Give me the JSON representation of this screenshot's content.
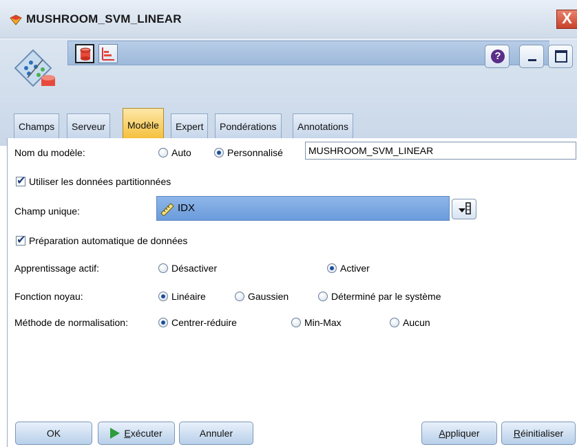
{
  "window": {
    "title": "MUSHROOM_SVM_LINEAR",
    "close_glyph": "X"
  },
  "toolbar": {
    "help_glyph": "?"
  },
  "tabs": [
    {
      "label": "Champs"
    },
    {
      "label": "Serveur"
    },
    {
      "label": "Modèle",
      "active": true
    },
    {
      "label": "Expert"
    },
    {
      "label": "Pondérations"
    },
    {
      "label": "Annotations"
    }
  ],
  "form": {
    "model_name": {
      "label": "Nom du modèle:",
      "options": [
        "Auto",
        "Personnalisé"
      ],
      "selected": "Personnalisé",
      "value": "MUSHROOM_SVM_LINEAR"
    },
    "use_partitioned": {
      "label": "Utiliser les données partitionnées",
      "checked": true
    },
    "unique_field": {
      "label": "Champ unique:",
      "value": "IDX"
    },
    "auto_prep": {
      "label": "Préparation automatique de données",
      "checked": true
    },
    "active_learning": {
      "label": "Apprentissage actif:",
      "options": [
        "Désactiver",
        "Activer"
      ],
      "selected": "Activer"
    },
    "kernel": {
      "label": "Fonction noyau:",
      "options": [
        "Linéaire",
        "Gaussien",
        "Déterminé par le système"
      ],
      "selected": "Linéaire"
    },
    "normalization": {
      "label": "Méthode de normalisation:",
      "options": [
        "Centrer-réduire",
        "Min-Max",
        "Aucun"
      ],
      "selected": "Centrer-réduire"
    }
  },
  "buttons": {
    "ok": "OK",
    "run_u": "E",
    "run_rest": "xécuter",
    "cancel": "Annuler",
    "apply_u": "A",
    "apply_rest": "ppliquer",
    "reset_u": "R",
    "reset_rest": "éinitialiser"
  },
  "colors": {
    "active_tab": "#f5c13e",
    "field_box": "#7aa7e2",
    "run_arrow": "#2e9b3d",
    "close_button": "#c9412b"
  }
}
